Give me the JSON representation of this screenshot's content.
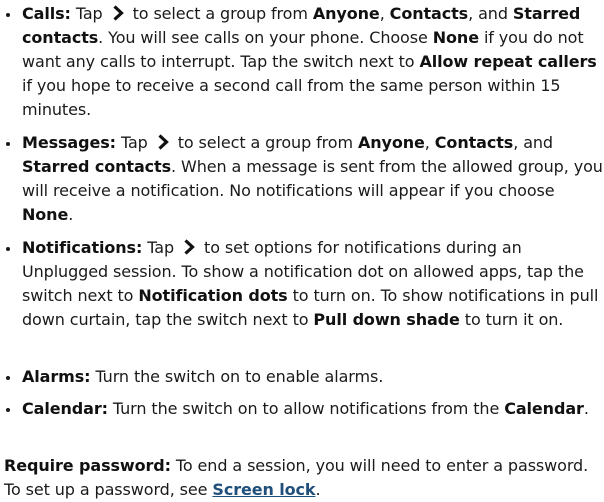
{
  "colors": {
    "text": "#1a1a1a",
    "link": "#1f4f7a"
  },
  "icons": {
    "chevron": "chevron-right-icon",
    "bullet": "bullet-dot"
  },
  "items": [
    {
      "title": "Calls:",
      "t1": " Tap ",
      "t2": " to select a group from ",
      "b1": "Anyone",
      "t3": ", ",
      "b2": "Contacts",
      "t4": ", and ",
      "b3": "Starred contacts",
      "t5": ". You will see calls on your phone. Choose ",
      "b4": "None",
      "t6": " if you do not want any calls to interrupt. Tap the switch next to ",
      "b5": "Allow repeat callers",
      "t7": " if you hope to receive a second call from the same person within 15 minutes."
    },
    {
      "title": "Messages:",
      "t1": " Tap ",
      "t2": " to select a group from ",
      "b1": "Anyone",
      "t3": ", ",
      "b2": "Contacts",
      "t4": ", and ",
      "b3": "Starred contacts",
      "t5": ". When a message is sent from the allowed group, you will receive a notification. No notifications will appear if you choose ",
      "b4": "None",
      "t6": "."
    },
    {
      "title": "Notifications:",
      "t1": " Tap ",
      "t2": " to set options for notifications during an Unplugged session. To show a notification dot on allowed apps, tap the switch next to ",
      "b1": "Notification dots",
      "t3": " to turn on. To show notifications in pull down curtain, tap the switch next to ",
      "b2": "Pull down shade",
      "t4": " to turn it on."
    },
    {
      "title": "Alarms:",
      "t1": " Turn the switch on to enable alarms."
    },
    {
      "title": "Calendar:",
      "t1": " Turn the switch on to allow notifications from the ",
      "b1": "Calendar",
      "t2": "."
    }
  ],
  "footer": {
    "title": "Require password:",
    "t1": " To end a session, you will need to enter a password. To set up a password, see ",
    "link": "Screen lock",
    "t2": "."
  }
}
